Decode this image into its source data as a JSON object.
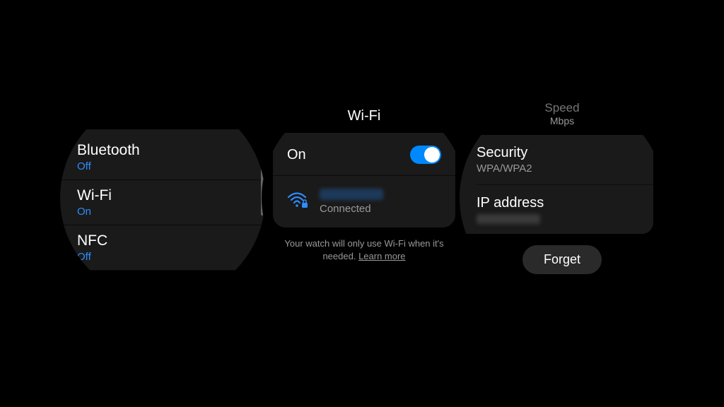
{
  "watch1": {
    "items": [
      {
        "title": "Bluetooth",
        "status": "Off"
      },
      {
        "title": "Wi-Fi",
        "status": "On"
      },
      {
        "title": "NFC",
        "status": "Off"
      }
    ]
  },
  "watch2": {
    "header": "Wi-Fi",
    "on_label": "On",
    "connected_label": "Connected",
    "footer_text": "Your watch will only use Wi-Fi when it's needed. ",
    "learn_more": "Learn more"
  },
  "watch3": {
    "top_label": "Speed",
    "top_value": "Mbps",
    "security_label": "Security",
    "security_value": "WPA/WPA2",
    "ip_label": "IP address",
    "forget_label": "Forget"
  }
}
